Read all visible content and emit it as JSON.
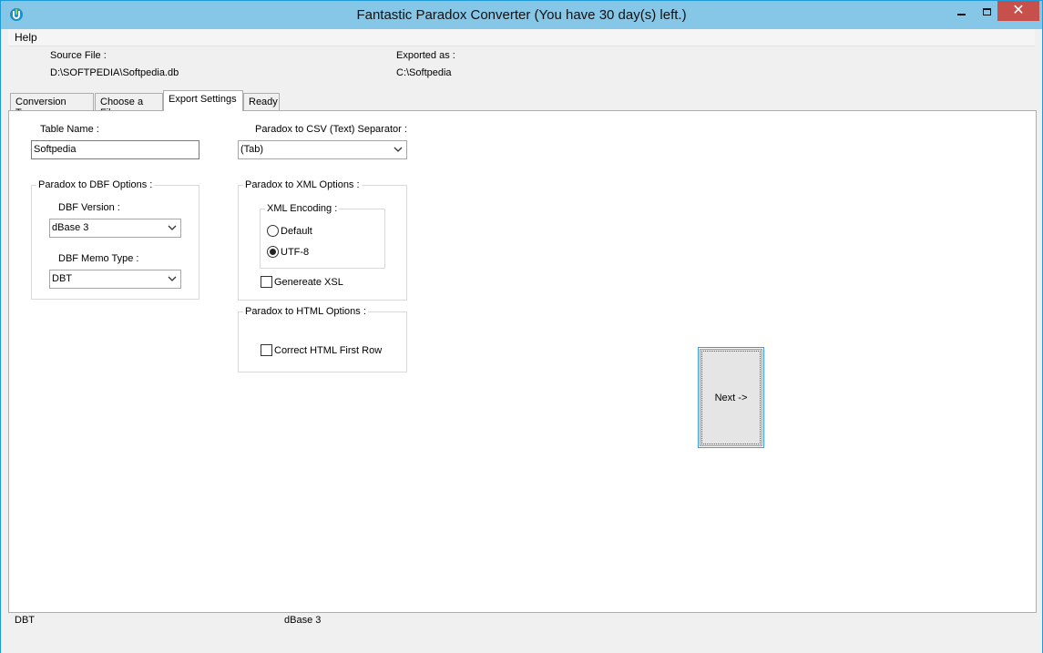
{
  "window": {
    "title": "Fantastic Paradox Converter  (You have 30 day(s) left.)",
    "icons": {
      "app": "app-icon",
      "minimize": "minimize-icon",
      "maximize": "maximize-icon",
      "close": "close-icon"
    }
  },
  "menu": {
    "items": [
      {
        "label": "Help"
      }
    ]
  },
  "header": {
    "source_label": "Source File :",
    "source_value": "D:\\SOFTPEDIA\\Softpedia.db",
    "export_label": "Exported as :",
    "export_value": "C:\\Softpedia"
  },
  "tabs": [
    {
      "label": "Conversion Type"
    },
    {
      "label": "Choose a File"
    },
    {
      "label": "Export Settings",
      "active": true
    },
    {
      "label": "Ready"
    }
  ],
  "export_settings": {
    "table_name_label": "Table Name :",
    "table_name_value": "Softpedia",
    "csv_separator_label": "Paradox to CSV (Text) Separator :",
    "csv_separator_value": "(Tab)",
    "dbf_group_title": "Paradox to DBF Options :",
    "dbf_version_label": "DBF Version :",
    "dbf_version_value": "dBase 3",
    "dbf_memo_label": "DBF Memo Type :",
    "dbf_memo_value": "DBT",
    "xml_group_title": "Paradox to XML Options :",
    "xml_encoding_title": "XML Encoding :",
    "encoding_default_label": "Default",
    "encoding_utf8_label": "UTF-8",
    "encoding_selected": "UTF-8",
    "generate_xsl_label": "Genereate XSL",
    "generate_xsl_checked": false,
    "html_group_title": "Paradox to HTML Options :",
    "correct_html_label": "Correct HTML First Row",
    "correct_html_checked": false
  },
  "next_button": {
    "label": "Next ->"
  },
  "status": {
    "left": "DBT",
    "right": "dBase 3"
  },
  "colors": {
    "titlebar": "#86c7e8",
    "close": "#c7504c",
    "focus": "#3399ff"
  }
}
